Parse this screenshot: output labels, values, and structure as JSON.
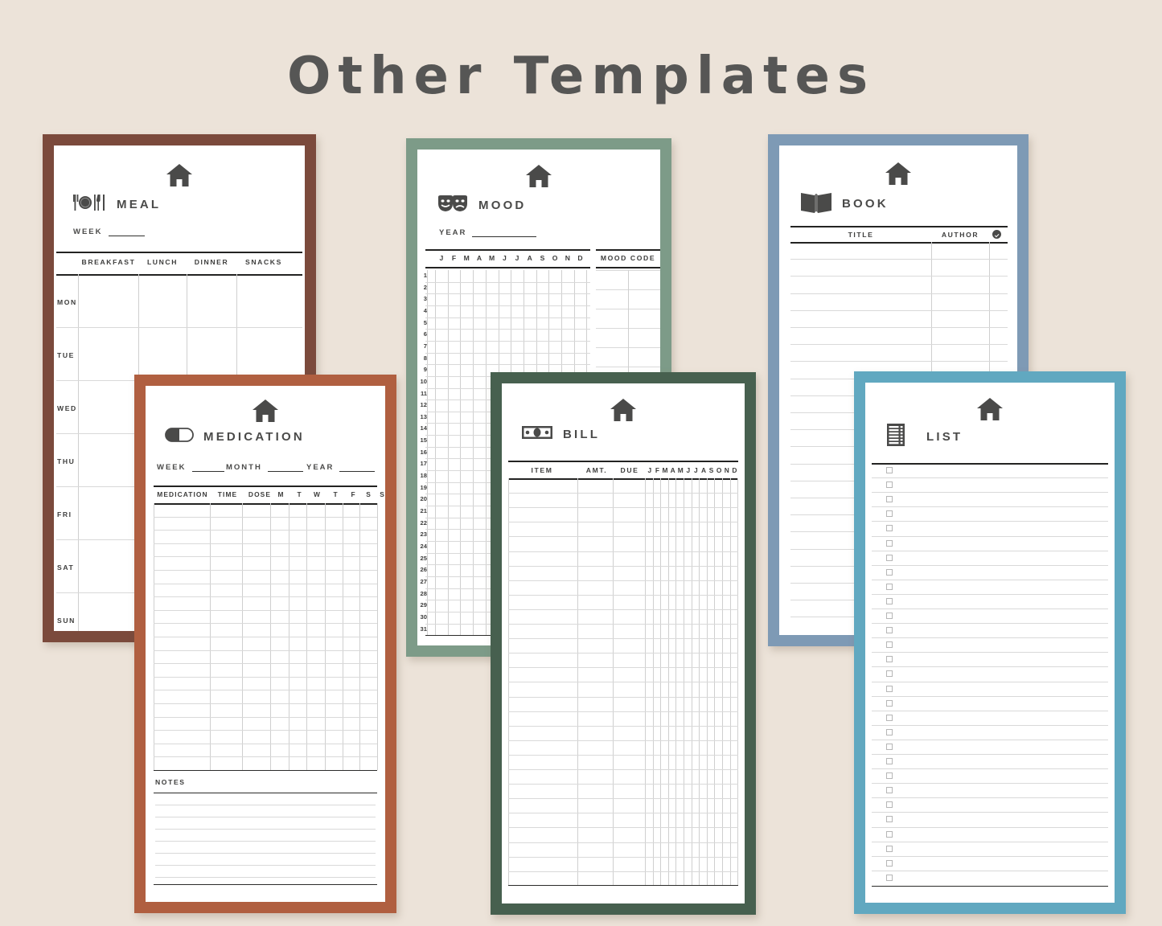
{
  "page": {
    "title": "Other Templates",
    "background_color": "#ece3d9",
    "title_color": "#565655"
  },
  "icons": {
    "home": "house-icon",
    "meal": "plate-cutlery-icon",
    "medication": "pill-icon",
    "mood": "theater-masks-icon",
    "bill": "banknote-icon",
    "book": "open-book-icon",
    "list": "list-clipboard-icon",
    "check": "check-circle-icon"
  },
  "templates": [
    {
      "id": "meal",
      "title": "MEAL",
      "border_color": "#7b4a3c",
      "icon": "plate-cutlery-icon",
      "fields": [
        {
          "label": "WEEK",
          "value": ""
        }
      ],
      "columns": [
        "BREAKFAST",
        "LUNCH",
        "DINNER",
        "SNACKS"
      ],
      "rows": [
        "MON",
        "TUE",
        "WED",
        "THU",
        "FRI",
        "SAT",
        "SUN"
      ]
    },
    {
      "id": "medication",
      "title": "MEDICATION",
      "border_color": "#b05f40",
      "icon": "pill-icon",
      "fields": [
        {
          "label": "WEEK",
          "value": ""
        },
        {
          "label": "MONTH",
          "value": ""
        },
        {
          "label": "YEAR",
          "value": ""
        }
      ],
      "columns": [
        "MEDICATION",
        "TIME",
        "DOSE",
        "M",
        "T",
        "W",
        "T",
        "F",
        "S",
        "S"
      ],
      "row_count": 20,
      "notes_label": "NOTES",
      "notes_line_count": 7
    },
    {
      "id": "mood",
      "title": "MOOD",
      "border_color": "#7d9b88",
      "icon": "theater-masks-icon",
      "fields": [
        {
          "label": "YEAR",
          "value": ""
        }
      ],
      "month_columns": [
        "J",
        "F",
        "M",
        "A",
        "M",
        "J",
        "J",
        "A",
        "S",
        "O",
        "N",
        "D"
      ],
      "side_panel_header": "MOOD CODE",
      "day_numbers": [
        1,
        2,
        3,
        4,
        5,
        6,
        7,
        8,
        9,
        10,
        11,
        12,
        13,
        14,
        15,
        16,
        17,
        18,
        19,
        20,
        21,
        22,
        23,
        24,
        25,
        26,
        27,
        28,
        29,
        30,
        31
      ]
    },
    {
      "id": "bill",
      "title": "BILL",
      "border_color": "#47604f",
      "icon": "banknote-icon",
      "fields": [],
      "columns": [
        "ITEM",
        "AMT.",
        "DUE"
      ],
      "month_columns": [
        "J",
        "F",
        "M",
        "A",
        "M",
        "J",
        "J",
        "A",
        "S",
        "O",
        "N",
        "D"
      ],
      "row_count": 28
    },
    {
      "id": "book",
      "title": "BOOK",
      "border_color": "#7e9ab5",
      "icon": "open-book-icon",
      "fields": [],
      "columns": [
        "TITLE",
        "AUTHOR",
        "check-circle-icon"
      ],
      "row_count": 22
    },
    {
      "id": "list",
      "title": "LIST",
      "border_color": "#61a8c0",
      "icon": "list-clipboard-icon",
      "fields": [],
      "checkbox_count": 29
    }
  ]
}
